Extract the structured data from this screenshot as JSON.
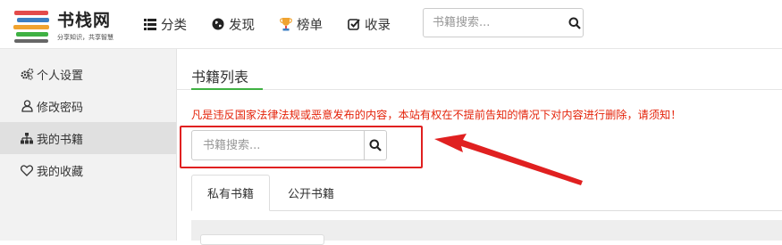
{
  "logo": {
    "title": "书栈网",
    "slogan": "分享知识，共享智慧"
  },
  "nav": {
    "items": [
      {
        "label": "分类",
        "icon": "list-icon"
      },
      {
        "label": "发现",
        "icon": "globe-icon"
      },
      {
        "label": "榜单",
        "icon": "trophy-icon"
      },
      {
        "label": "收录",
        "icon": "check-square-icon"
      }
    ],
    "search_placeholder": "书籍搜索..."
  },
  "sidebar": {
    "items": [
      {
        "label": "个人设置",
        "icon": "cogs-icon"
      },
      {
        "label": "修改密码",
        "icon": "user-icon"
      },
      {
        "label": "我的书籍",
        "icon": "sitemap-icon",
        "active": true
      },
      {
        "label": "我的收藏",
        "icon": "heart-icon"
      }
    ]
  },
  "main": {
    "title": "书籍列表",
    "warning": "凡是违反国家法律法规或恶意发布的内容，本站有权在不提前告知的情况下对内容进行删除，请须知！",
    "search_placeholder": "书籍搜索...",
    "tabs": [
      {
        "label": "私有书籍",
        "active": true
      },
      {
        "label": "公开书籍"
      }
    ]
  },
  "colors": {
    "accent": "#3fb143",
    "warning": "#e4230a",
    "annotation": "#e02020"
  }
}
